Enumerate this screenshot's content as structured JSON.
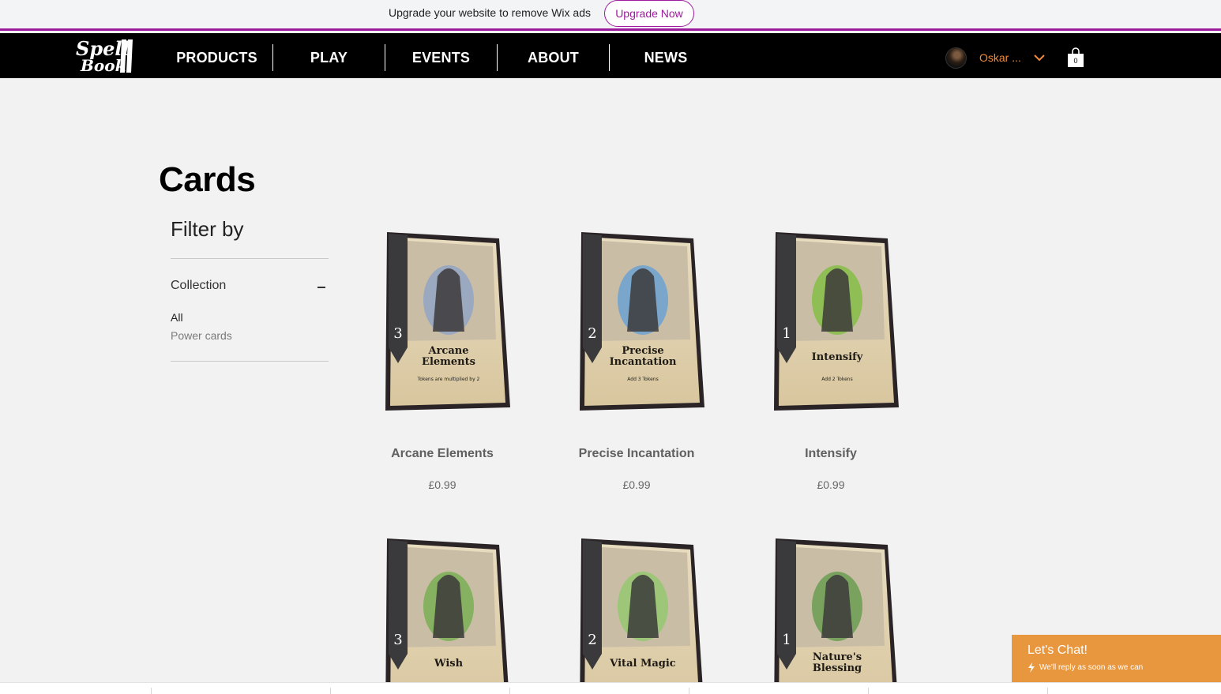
{
  "adbar": {
    "text": "Upgrade your website to remove Wix ads",
    "button": "Upgrade Now"
  },
  "header": {
    "nav": [
      "PRODUCTS",
      "PLAY",
      "EVENTS",
      "ABOUT",
      "NEWS"
    ],
    "user_name": "Oskar ...",
    "cart_count": "0"
  },
  "main": {
    "title": "Cards",
    "filter": {
      "title": "Filter by",
      "collection_label": "Collection",
      "options": [
        "All",
        "Power cards"
      ]
    },
    "products": [
      {
        "name": "Arcane Elements",
        "price": "£0.99",
        "card_value": "3",
        "card_title": [
          "Arcane",
          "Elements"
        ],
        "card_text": "Tokens are multiplied by 2",
        "art_color": "#8aa2c8"
      },
      {
        "name": "Precise Incantation",
        "price": "£0.99",
        "card_value": "2",
        "card_title": [
          "Precise",
          "Incantation"
        ],
        "card_text": "Add 3 Tokens",
        "art_color": "#5f9fd8"
      },
      {
        "name": "Intensify",
        "price": "£0.99",
        "card_value": "1",
        "card_title": [
          "Intensify"
        ],
        "card_text": "Add 2 Tokens",
        "art_color": "#7bbf3a"
      },
      {
        "name": "",
        "price": "",
        "card_value": "3",
        "card_title": [
          "Wish"
        ],
        "card_text": "",
        "art_color": "#6fae4a"
      },
      {
        "name": "",
        "price": "",
        "card_value": "2",
        "card_title": [
          "Vital Magic"
        ],
        "card_text": "",
        "art_color": "#8ec96a"
      },
      {
        "name": "",
        "price": "",
        "card_value": "1",
        "card_title": [
          "Nature's",
          "Blessing"
        ],
        "card_text": "",
        "art_color": "#5c9a46"
      }
    ]
  },
  "chat": {
    "title": "Let's Chat!",
    "subtitle": "We'll reply as soon as we can"
  },
  "colors": {
    "brand_purple": "#9c1b9c",
    "accent_orange": "#f08a3c",
    "chat_bg": "#e8973f",
    "header_bg": "#000000",
    "page_bg": "#f2f2f2"
  }
}
